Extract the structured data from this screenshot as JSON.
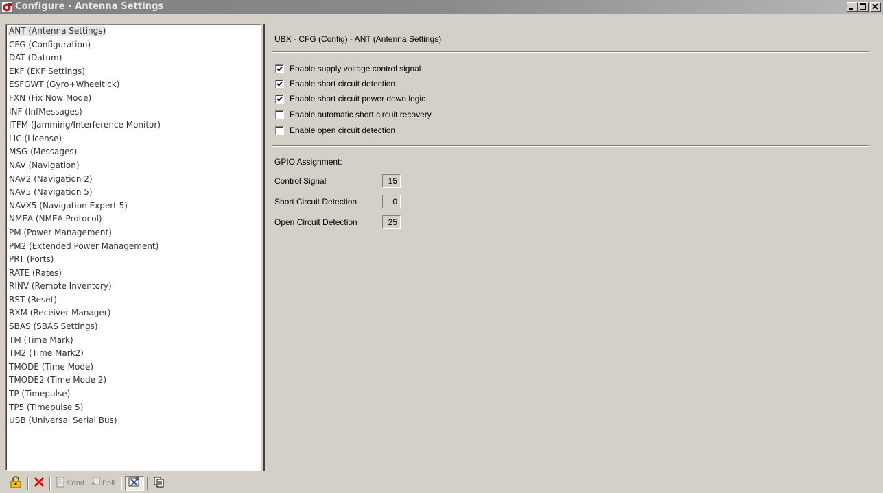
{
  "window": {
    "title": "Configure - Antenna Settings",
    "icon": "ublox-app-icon"
  },
  "messages": [
    {
      "label": "ANT (Antenna Settings)",
      "selected": true
    },
    {
      "label": "CFG (Configuration)"
    },
    {
      "label": "DAT (Datum)"
    },
    {
      "label": "EKF (EKF Settings)"
    },
    {
      "label": "ESFGWT (Gyro+Wheeltick)"
    },
    {
      "label": "FXN (Fix Now Mode)"
    },
    {
      "label": "INF (InfMessages)"
    },
    {
      "label": "ITFM (Jamming/Interference Monitor)"
    },
    {
      "label": "LIC (License)"
    },
    {
      "label": "MSG (Messages)"
    },
    {
      "label": "NAV (Navigation)"
    },
    {
      "label": "NAV2 (Navigation 2)"
    },
    {
      "label": "NAV5 (Navigation 5)"
    },
    {
      "label": "NAVX5 (Navigation Expert 5)"
    },
    {
      "label": "NMEA (NMEA Protocol)"
    },
    {
      "label": "PM (Power Management)"
    },
    {
      "label": "PM2 (Extended Power Management)"
    },
    {
      "label": "PRT (Ports)"
    },
    {
      "label": "RATE (Rates)"
    },
    {
      "label": "RINV (Remote Inventory)"
    },
    {
      "label": "RST (Reset)"
    },
    {
      "label": "RXM (Receiver Manager)"
    },
    {
      "label": "SBAS (SBAS Settings)"
    },
    {
      "label": "TM (Time Mark)"
    },
    {
      "label": "TM2 (Time Mark2)"
    },
    {
      "label": "TMODE (Time Mode)"
    },
    {
      "label": "TMODE2 (Time Mode 2)"
    },
    {
      "label": "TP (Timepulse)"
    },
    {
      "label": "TP5 (Timepulse 5)"
    },
    {
      "label": "USB (Universal Serial Bus)"
    }
  ],
  "panel": {
    "title": "UBX - CFG (Config) - ANT (Antenna Settings)",
    "options": [
      {
        "label": "Enable supply voltage control signal",
        "checked": true
      },
      {
        "label": "Enable short circuit detection",
        "checked": true
      },
      {
        "label": "Enable short circuit power down logic",
        "checked": true
      },
      {
        "label": "Enable automatic short circuit recovery",
        "checked": false
      },
      {
        "label": "Enable open circuit detection",
        "checked": false
      }
    ],
    "gpio_title": "GPIO Assignment:",
    "gpio": [
      {
        "label": "Control Signal",
        "value": "15"
      },
      {
        "label": "Short Circuit Detection",
        "value": "0"
      },
      {
        "label": "Open Circuit Detection",
        "value": "25"
      }
    ]
  },
  "toolbar": {
    "lock_icon": "lock-icon",
    "revert_icon": "red-x-icon",
    "send_label": "Send",
    "poll_label": "Poll",
    "config_icon": "tools-icon",
    "copy_icon": "copy-icon"
  },
  "colors": {
    "face": "#d4d0c8",
    "title_bar": "#808080",
    "list_text": "#333333"
  }
}
